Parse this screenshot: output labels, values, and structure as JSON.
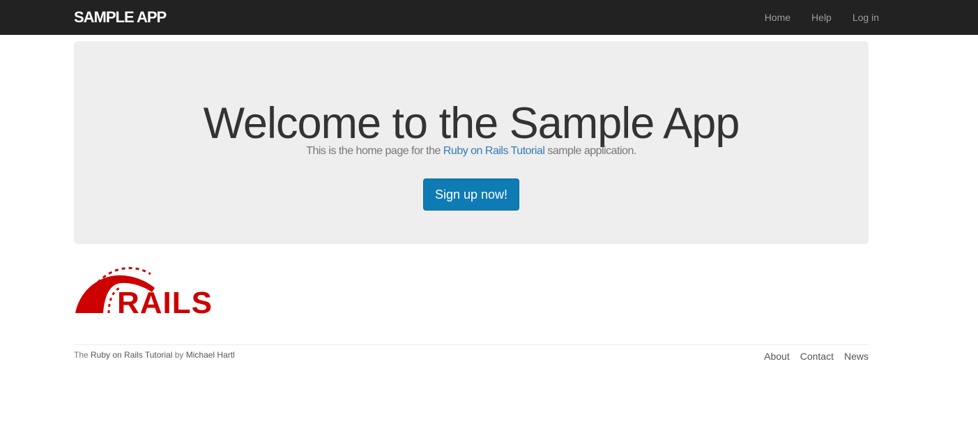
{
  "header": {
    "brand": "SAMPLE APP",
    "nav": [
      {
        "label": "Home"
      },
      {
        "label": "Help"
      },
      {
        "label": "Log in"
      }
    ]
  },
  "hero": {
    "title": "Welcome to the Sample App",
    "lead_prefix": "This is the home page for the ",
    "lead_link": "Ruby on Rails Tutorial",
    "lead_suffix": " sample application.",
    "signup_label": "Sign up now!"
  },
  "logo": {
    "text": "RAILS",
    "icon": "rails-logo-icon",
    "color": "#cc0000"
  },
  "footer": {
    "prefix": "The ",
    "tutorial_link": "Ruby on Rails Tutorial",
    "by": " by ",
    "author_link": "Michael Hartl",
    "links": [
      {
        "label": "About"
      },
      {
        "label": "Contact"
      },
      {
        "label": "News"
      }
    ]
  },
  "colors": {
    "navbar": "#222222",
    "jumbotron": "#eeeeee",
    "primary_button": "#0e7bb5",
    "link": "#337ab7"
  }
}
